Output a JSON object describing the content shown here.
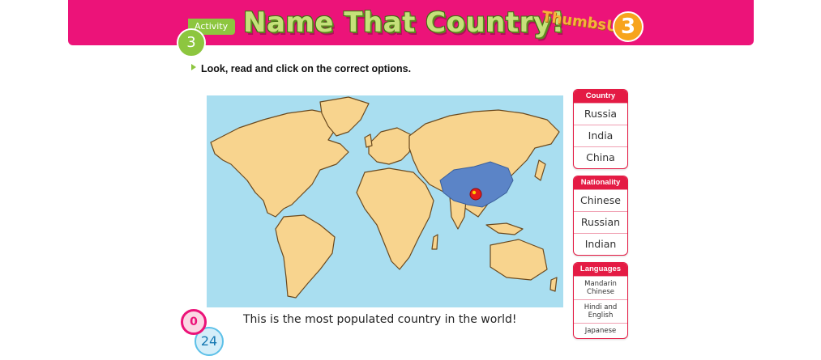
{
  "header": {
    "activity_label": "Activity",
    "activity_number": "3",
    "title": "Name That Country!",
    "logo_text": "ThumbsUp!",
    "logo_number": "3"
  },
  "instruction": "Look, read and click on the correct options.",
  "map": {
    "highlighted_country_color": "#5b84c7",
    "land_color": "#f8d48e",
    "water_color": "#a9def0"
  },
  "panels": {
    "country": {
      "heading": "Country",
      "options": [
        "Russia",
        "India",
        "China"
      ]
    },
    "nationality": {
      "heading": "Nationality",
      "options": [
        "Chinese",
        "Russian",
        "Indian"
      ]
    },
    "languages": {
      "heading": "Languages",
      "options": [
        "Mandarin Chinese",
        "Hindi and English",
        "Japanese"
      ]
    }
  },
  "sentence": "This is the most populated country in the world!",
  "score": {
    "current": "0",
    "total": "24"
  },
  "colors": {
    "header": "#ec1379",
    "accent_green": "#8dc63f",
    "panel_red": "#e41b44"
  }
}
